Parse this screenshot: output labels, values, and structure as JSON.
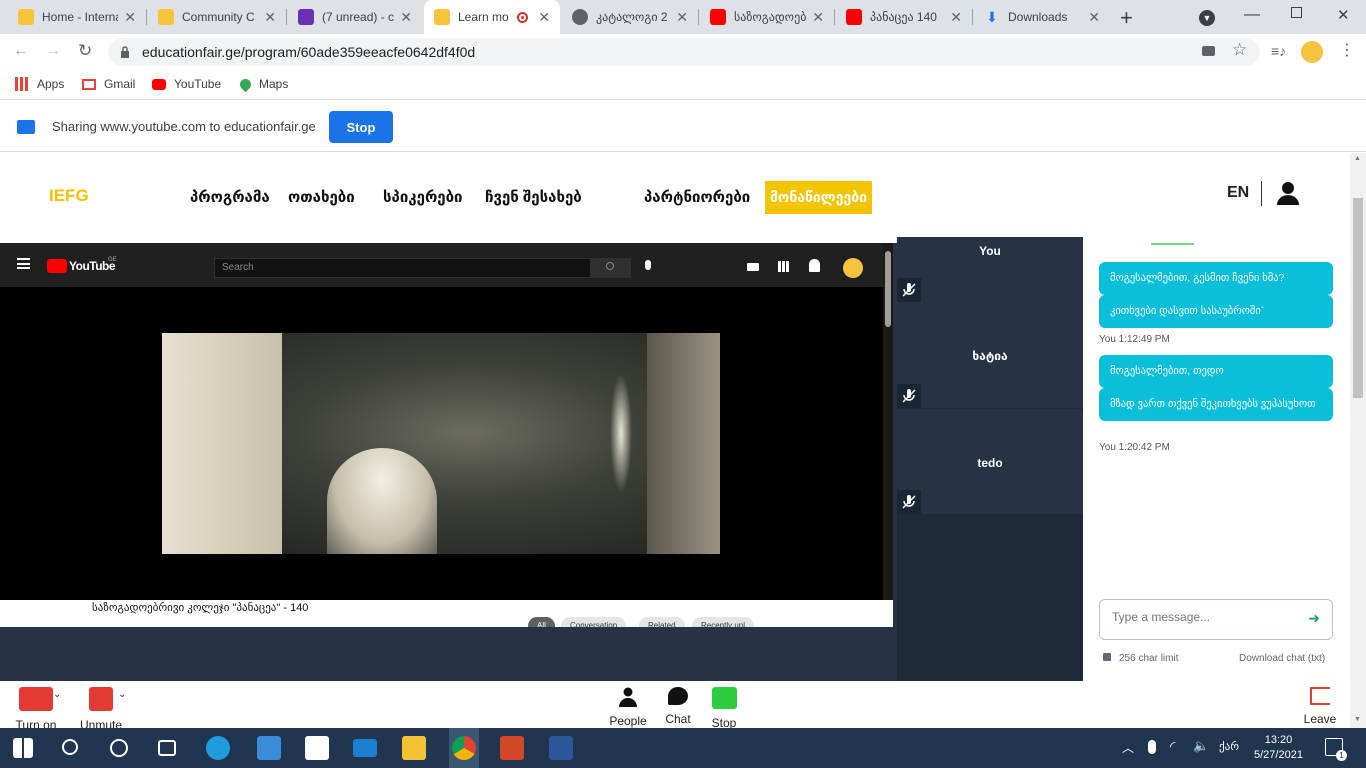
{
  "browser": {
    "tabs": [
      {
        "title": "Home - Interna",
        "active": false
      },
      {
        "title": "Community C",
        "active": false
      },
      {
        "title": "(7 unread) - c",
        "active": false
      },
      {
        "title": "Learn mo",
        "active": true
      },
      {
        "title": "კატალოგი 2",
        "active": false
      },
      {
        "title": "საზოგადოებ",
        "active": false
      },
      {
        "title": "პანაცეა 140",
        "active": false
      },
      {
        "title": "Downloads",
        "active": false
      }
    ],
    "new_tab": "+",
    "url": "educationfair.ge/program/60ade359eeacfe0642df4f0d",
    "bookmarks": [
      "Apps",
      "Gmail",
      "YouTube",
      "Maps"
    ]
  },
  "share_bar": {
    "text": "Sharing www.youtube.com to educationfair.ge",
    "stop_label": "Stop"
  },
  "site": {
    "logo": "IEFG",
    "nav": [
      "პროგრამა",
      "ოთახები",
      "სპიკერები",
      "ჩვენ შესახებ",
      "პარტნიორები"
    ],
    "nav_active": "მონაწილეები",
    "lang": "EN"
  },
  "youtube": {
    "logo": "YouTube",
    "region": "GE",
    "search_placeholder": "Search",
    "caption": "საზოგადოებრივი კოლეჯი \"პანაცეა\" - 140",
    "chips": [
      "All",
      "Conversation",
      "Related",
      "Recently upl"
    ]
  },
  "participants": [
    {
      "name": "You"
    },
    {
      "name": "ხატია"
    },
    {
      "name": "tedo"
    }
  ],
  "chat": {
    "groups": [
      {
        "messages": [
          "მოგესალმებით, გესმით ჩვენი ხმა?",
          "კითხვები დასვით სასაუბროში`"
        ],
        "time": "You 1:12:49 PM"
      },
      {
        "messages": [
          "მოგესალმებით, თედო",
          "მზად ვართ თქვენ შეკითხვებს ვუპასუხოთ"
        ],
        "time": "You 1:20:42 PM"
      }
    ],
    "input_placeholder": "Type a message...",
    "char_limit": "256 char limit",
    "download": "Download chat (txt)"
  },
  "controls": {
    "turn_on": "Turn on",
    "unmute": "Unmute",
    "people": "People",
    "chat": "Chat",
    "stop": "Stop",
    "leave": "Leave"
  },
  "taskbar": {
    "time": "13:20",
    "date": "5/27/2021",
    "lang": "ქარ",
    "notifications": "1"
  },
  "colors": {
    "accent_yellow": "#f5c400",
    "chat_bubble": "#0bbfdb",
    "stage_bg": "#253345",
    "share_stop": "#1a73e8"
  }
}
